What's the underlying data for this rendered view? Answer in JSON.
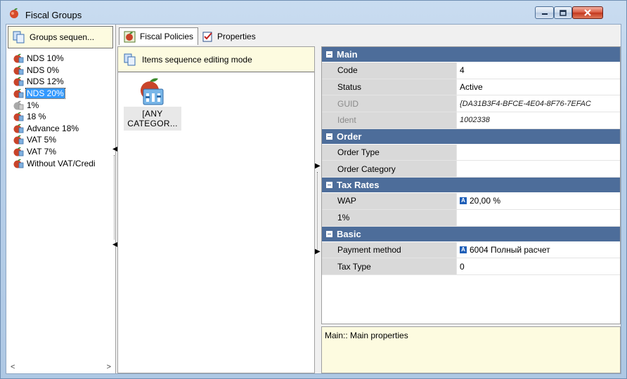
{
  "window": {
    "title": "Fiscal Groups"
  },
  "left": {
    "groups_button": "Groups sequen...",
    "items": [
      {
        "label": "NDS 10%",
        "icon": "apple-group-icon",
        "selected": false
      },
      {
        "label": "NDS 0%",
        "icon": "apple-group-icon",
        "selected": false
      },
      {
        "label": "NDS 12%",
        "icon": "apple-group-icon",
        "selected": false
      },
      {
        "label": "NDS 20%",
        "icon": "apple-group-icon",
        "selected": true
      },
      {
        "label": "1%",
        "icon": "apple-group-gray-icon",
        "selected": false
      },
      {
        "label": "18 %",
        "icon": "apple-group-icon",
        "selected": false
      },
      {
        "label": "Advance 18%",
        "icon": "apple-group-icon",
        "selected": false
      },
      {
        "label": "VAT 5%",
        "icon": "apple-group-icon",
        "selected": false
      },
      {
        "label": "VAT 7%",
        "icon": "apple-group-icon",
        "selected": false
      },
      {
        "label": "Without VAT/Credi",
        "icon": "apple-group-icon",
        "selected": false
      }
    ],
    "scroll_left": "<",
    "scroll_right": ">"
  },
  "tabs": [
    {
      "label": "Fiscal Policies",
      "active": true
    },
    {
      "label": "Properties",
      "active": false
    }
  ],
  "middle": {
    "mode_label": "Items sequence editing mode",
    "item_label": "[ANY CATEGOR..."
  },
  "properties": {
    "categories": [
      {
        "name": "Main",
        "rows": [
          {
            "name": "Code",
            "value": "4",
            "disabled": false,
            "italic": false
          },
          {
            "name": "Status",
            "value": "Active",
            "disabled": false,
            "italic": false
          },
          {
            "name": "GUID",
            "value": "{DA31B3F4-BFCE-4E04-8F76-7EFAC",
            "disabled": true,
            "italic": true
          },
          {
            "name": "Ident",
            "value": "1002338",
            "disabled": true,
            "italic": true
          }
        ]
      },
      {
        "name": "Order",
        "rows": [
          {
            "name": "Order Type",
            "value": "",
            "disabled": false,
            "italic": false
          },
          {
            "name": "Order Category",
            "value": "",
            "disabled": false,
            "italic": false
          }
        ]
      },
      {
        "name": "Tax Rates",
        "rows": [
          {
            "name": "WAP",
            "value": "20,00 %",
            "badge": "A",
            "disabled": false,
            "italic": false
          },
          {
            "name": "1%",
            "value": "",
            "disabled": false,
            "italic": false
          }
        ]
      },
      {
        "name": "Basic",
        "rows": [
          {
            "name": "Payment method",
            "value": "6004 Полный расчет",
            "badge": "A",
            "disabled": false,
            "italic": false
          },
          {
            "name": "Tax Type",
            "value": "0",
            "disabled": false,
            "italic": false
          }
        ]
      }
    ]
  },
  "description": "Main:: Main properties",
  "colors": {
    "category_bg": "#4d6d9a",
    "selection": "#3399ff",
    "info_bg": "#fdfbe0"
  }
}
